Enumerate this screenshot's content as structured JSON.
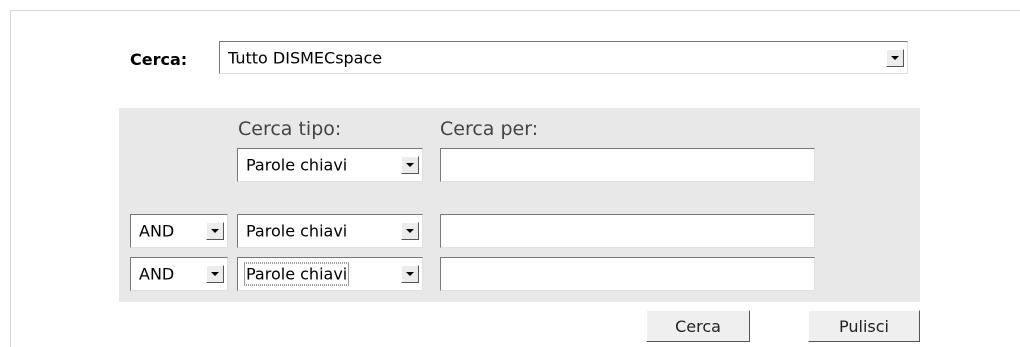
{
  "scope": {
    "label": "Cerca:",
    "value": "Tutto DISMECspace"
  },
  "headers": {
    "type": "Cerca tipo:",
    "query": "Cerca per:"
  },
  "rows": [
    {
      "type_value": "Parole chiavi",
      "query_value": ""
    },
    {
      "operator": "AND",
      "type_value": "Parole chiavi",
      "query_value": ""
    },
    {
      "operator": "AND",
      "type_value": "Parole chiavi",
      "query_value": ""
    }
  ],
  "buttons": {
    "search": "Cerca",
    "clear": "Pulisci"
  },
  "icons": {
    "dropdown": "chevron-down-icon"
  },
  "colors": {
    "panel_bg": "#e8e8e8"
  }
}
